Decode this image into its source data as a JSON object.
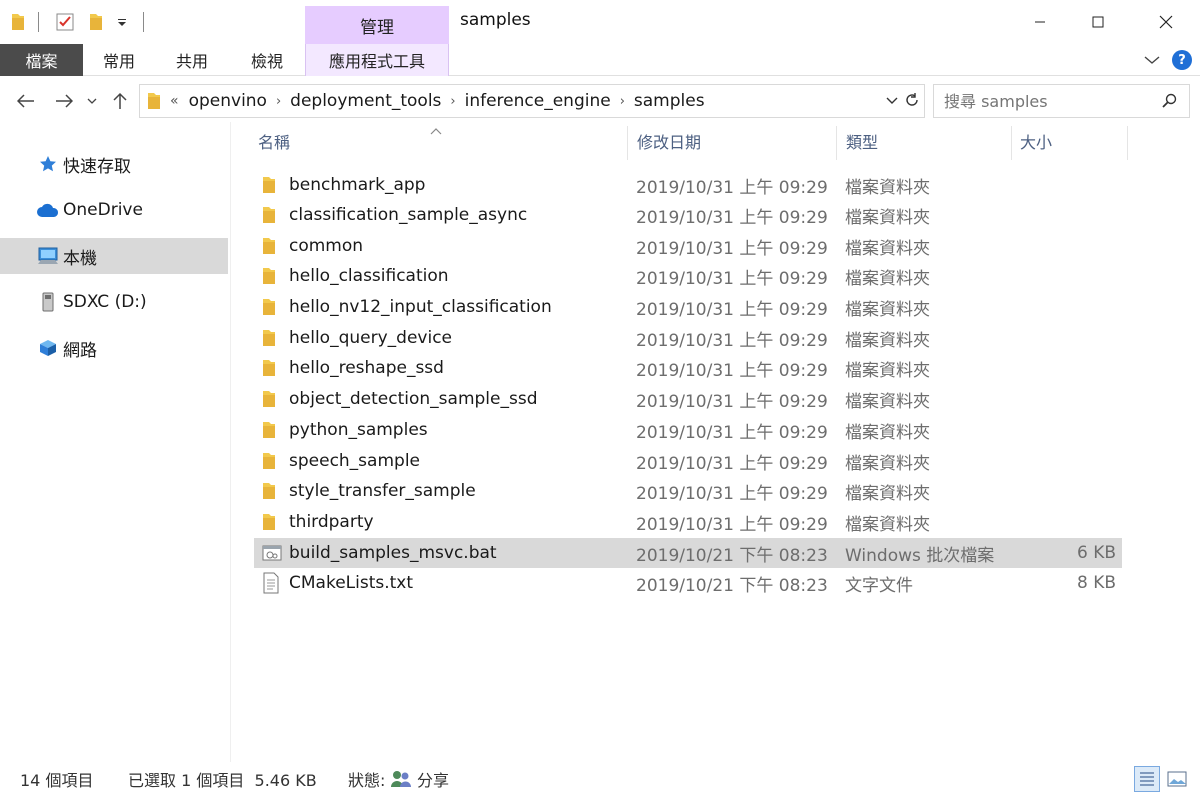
{
  "window": {
    "title": "samples",
    "context_tab": "管理",
    "controls": {
      "minimize": "—",
      "maximize": "☐",
      "close": "✕"
    }
  },
  "ribbon": {
    "tabs": [
      "檔案",
      "常用",
      "共用",
      "檢視",
      "應用程式工具"
    ],
    "expand": "⌄",
    "help": "?"
  },
  "address": {
    "prefix": "«",
    "crumbs": [
      "openvino",
      "deployment_tools",
      "inference_engine",
      "samples"
    ],
    "search_placeholder": "搜尋 samples"
  },
  "nav": {
    "items": [
      {
        "label": "快速存取",
        "icon": "star-icon"
      },
      {
        "label": "OneDrive",
        "icon": "cloud-icon"
      },
      {
        "label": "本機",
        "icon": "computer-icon",
        "selected": true
      },
      {
        "label": "SDXC (D:)",
        "icon": "drive-icon"
      },
      {
        "label": "網路",
        "icon": "network-icon"
      }
    ]
  },
  "columns": {
    "name": "名稱",
    "date": "修改日期",
    "type": "類型",
    "size": "大小"
  },
  "files": [
    {
      "name": "benchmark_app",
      "date": "2019/10/31 上午 09:29",
      "type": "檔案資料夾",
      "size": "",
      "icon": "folder-icon"
    },
    {
      "name": "classification_sample_async",
      "date": "2019/10/31 上午 09:29",
      "type": "檔案資料夾",
      "size": "",
      "icon": "folder-icon"
    },
    {
      "name": "common",
      "date": "2019/10/31 上午 09:29",
      "type": "檔案資料夾",
      "size": "",
      "icon": "folder-icon"
    },
    {
      "name": "hello_classification",
      "date": "2019/10/31 上午 09:29",
      "type": "檔案資料夾",
      "size": "",
      "icon": "folder-icon"
    },
    {
      "name": "hello_nv12_input_classification",
      "date": "2019/10/31 上午 09:29",
      "type": "檔案資料夾",
      "size": "",
      "icon": "folder-icon"
    },
    {
      "name": "hello_query_device",
      "date": "2019/10/31 上午 09:29",
      "type": "檔案資料夾",
      "size": "",
      "icon": "folder-icon"
    },
    {
      "name": "hello_reshape_ssd",
      "date": "2019/10/31 上午 09:29",
      "type": "檔案資料夾",
      "size": "",
      "icon": "folder-icon"
    },
    {
      "name": "object_detection_sample_ssd",
      "date": "2019/10/31 上午 09:29",
      "type": "檔案資料夾",
      "size": "",
      "icon": "folder-icon"
    },
    {
      "name": "python_samples",
      "date": "2019/10/31 上午 09:29",
      "type": "檔案資料夾",
      "size": "",
      "icon": "folder-icon"
    },
    {
      "name": "speech_sample",
      "date": "2019/10/31 上午 09:29",
      "type": "檔案資料夾",
      "size": "",
      "icon": "folder-icon"
    },
    {
      "name": "style_transfer_sample",
      "date": "2019/10/31 上午 09:29",
      "type": "檔案資料夾",
      "size": "",
      "icon": "folder-icon"
    },
    {
      "name": "thirdparty",
      "date": "2019/10/31 上午 09:29",
      "type": "檔案資料夾",
      "size": "",
      "icon": "folder-icon"
    },
    {
      "name": "build_samples_msvc.bat",
      "date": "2019/10/21 下午 08:23",
      "type": "Windows 批次檔案",
      "size": "6 KB",
      "icon": "batch-file-icon",
      "selected": true
    },
    {
      "name": "CMakeLists.txt",
      "date": "2019/10/21 下午 08:23",
      "type": "文字文件",
      "size": "8 KB",
      "icon": "text-file-icon"
    }
  ],
  "status": {
    "count": "14 個項目",
    "selection": "已選取 1 個項目  5.46 KB",
    "state_label": "狀態:",
    "state_value": "分享"
  },
  "colors": {
    "folder": "#f2c94c",
    "selected_row": "#d9d9d9",
    "manage_tab": "#e6ccff",
    "file_tab": "#4b4b4b",
    "accent": "#1f6fd6"
  }
}
